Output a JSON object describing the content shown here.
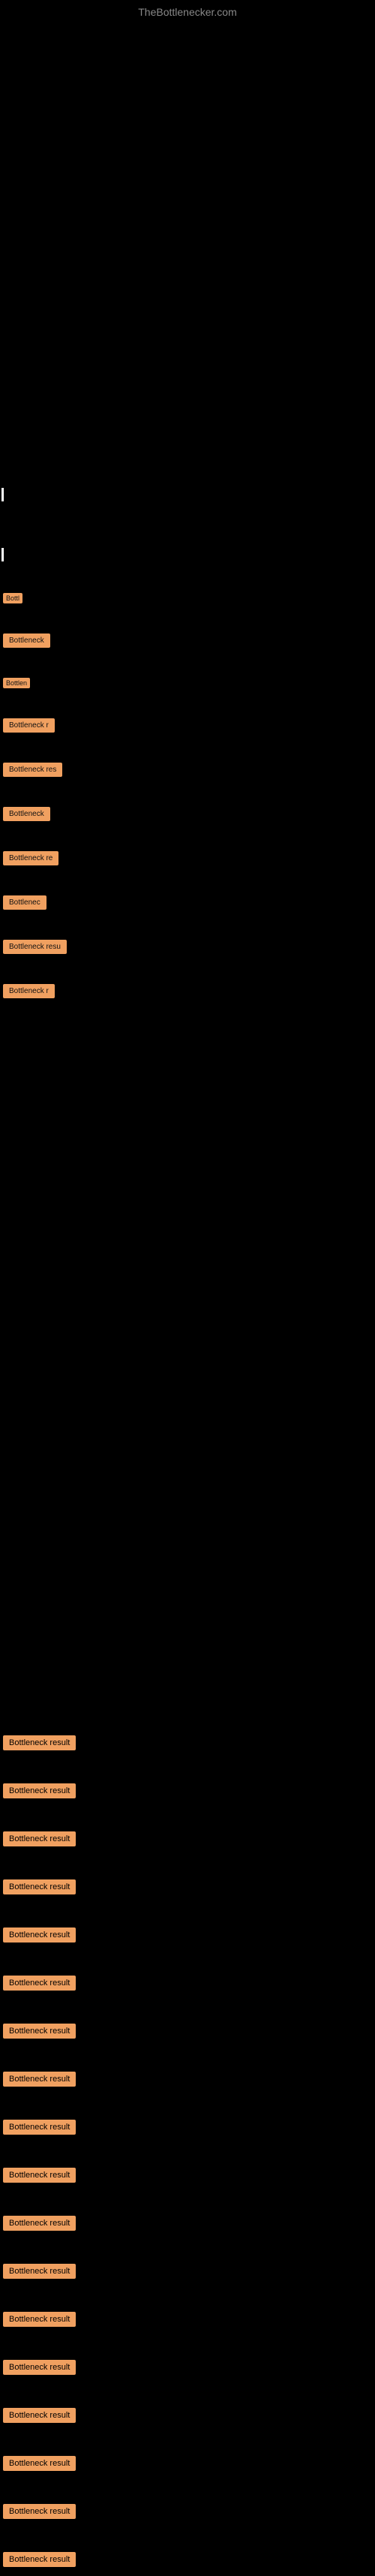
{
  "site": {
    "title": "TheBottlenecker.com"
  },
  "results": {
    "badge_label_short_1": "Bottl",
    "badge_label_short_2": "Bottleneck",
    "badge_label_short_3": "Bottlen",
    "badge_label_short_4": "Bottleneck r",
    "badge_label_short_5": "Bottleneck res",
    "badge_label_short_6": "Bottleneck",
    "badge_label_short_7": "Bottleneck re",
    "badge_label_short_8": "Bottlenec",
    "badge_label_short_9": "Bottleneck resu",
    "badge_label_short_10": "Bottleneck r",
    "badge_label_full": "Bottleneck result",
    "items": [
      {
        "label": "Bottleneck result"
      },
      {
        "label": "Bottleneck result"
      },
      {
        "label": "Bottleneck result"
      },
      {
        "label": "Bottleneck result"
      },
      {
        "label": "Bottleneck result"
      },
      {
        "label": "Bottleneck result"
      },
      {
        "label": "Bottleneck result"
      },
      {
        "label": "Bottleneck result"
      },
      {
        "label": "Bottleneck result"
      },
      {
        "label": "Bottleneck result"
      },
      {
        "label": "Bottleneck result"
      },
      {
        "label": "Bottleneck result"
      },
      {
        "label": "Bottleneck result"
      },
      {
        "label": "Bottleneck result"
      },
      {
        "label": "Bottleneck result"
      },
      {
        "label": "Bottleneck result"
      },
      {
        "label": "Bottleneck result"
      },
      {
        "label": "Bottleneck result"
      }
    ]
  }
}
